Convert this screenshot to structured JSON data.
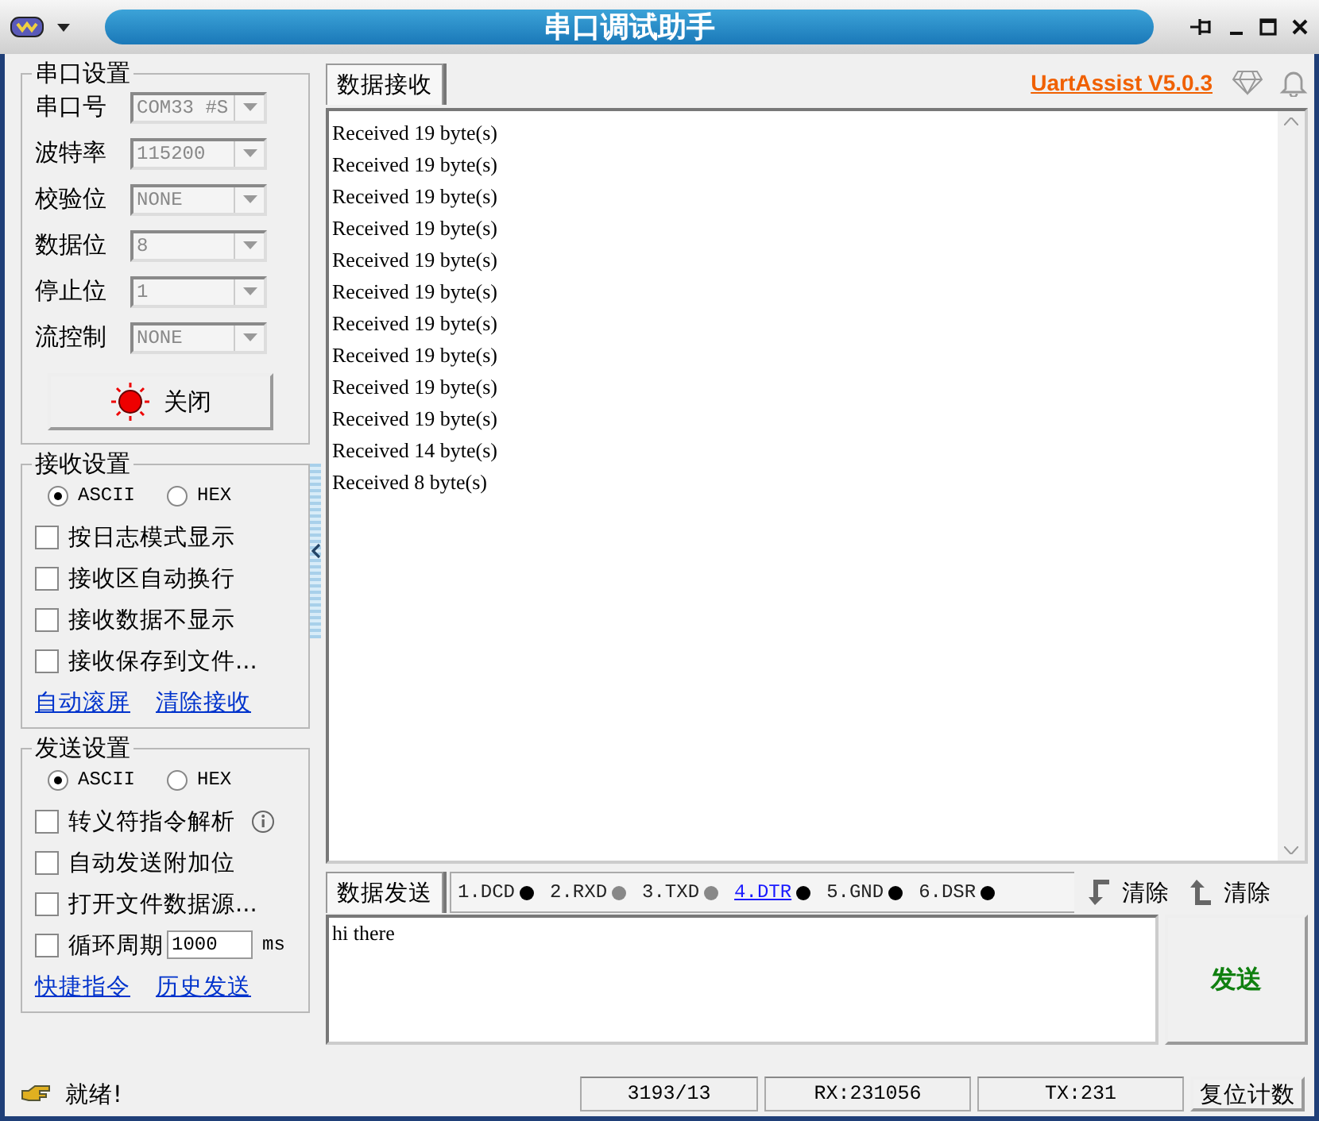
{
  "window": {
    "title": "串口调试助手"
  },
  "serial_settings": {
    "title": "串口设置",
    "fields": [
      {
        "label": "串口号",
        "value": "COM33 #S"
      },
      {
        "label": "波特率",
        "value": "115200"
      },
      {
        "label": "校验位",
        "value": "NONE"
      },
      {
        "label": "数据位",
        "value": "8"
      },
      {
        "label": "停止位",
        "value": "1"
      },
      {
        "label": "流控制",
        "value": "NONE"
      }
    ],
    "open_button": {
      "label": "关闭",
      "on": true
    }
  },
  "receive_settings": {
    "title": "接收设置",
    "modes": [
      {
        "label": "ASCII",
        "selected": true
      },
      {
        "label": "HEX",
        "selected": false
      }
    ],
    "options": [
      {
        "kind": "check",
        "label": "按日志模式显示",
        "checked": false
      },
      {
        "kind": "check",
        "label": "接收区自动换行",
        "checked": false
      },
      {
        "kind": "check",
        "label": "接收数据不显示",
        "checked": false
      },
      {
        "kind": "check",
        "label": "接收保存到文件...",
        "checked": false
      }
    ],
    "links": [
      "自动滚屏",
      "清除接收"
    ]
  },
  "send_settings": {
    "title": "发送设置",
    "modes": [
      {
        "label": "ASCII",
        "selected": true
      },
      {
        "label": "HEX",
        "selected": false
      }
    ],
    "options": [
      {
        "kind": "info",
        "label": "转义符指令解析",
        "checked": false
      },
      {
        "kind": "check",
        "label": "自动发送附加位",
        "checked": false
      },
      {
        "kind": "check",
        "label": "打开文件数据源...",
        "checked": false
      },
      {
        "kind": "period",
        "label": "循环周期",
        "checked": false,
        "value": "1000",
        "unit": "ms"
      }
    ],
    "links": [
      "快捷指令",
      "历史发送"
    ]
  },
  "receive": {
    "tab": "数据接收",
    "brand": "UartAssist V5.0.3",
    "lines": [
      "Received 19 byte(s)",
      "Received 19 byte(s)",
      "Received 19 byte(s)",
      "Received 19 byte(s)",
      "Received 19 byte(s)",
      "Received 19 byte(s)",
      "Received 19 byte(s)",
      "Received 19 byte(s)",
      "Received 19 byte(s)",
      "Received 19 byte(s)",
      "Received 14 byte(s)",
      "Received 8 byte(s)"
    ]
  },
  "send": {
    "tab": "数据发送",
    "signals": [
      {
        "label": "1.DCD",
        "on": true,
        "link": false
      },
      {
        "label": "2.RXD",
        "on": false,
        "link": false
      },
      {
        "label": "3.TXD",
        "on": false,
        "link": false
      },
      {
        "label": "4.DTR",
        "on": true,
        "link": true
      },
      {
        "label": "5.GND",
        "on": true,
        "link": false
      },
      {
        "label": "6.DSR",
        "on": true,
        "link": false
      }
    ],
    "clear_buttons": [
      {
        "kind": "down",
        "label": "清除"
      },
      {
        "kind": "up",
        "label": "清除"
      }
    ],
    "value": "hi there",
    "send_button": "发送"
  },
  "status_bar": {
    "message": "就绪!",
    "counts": [
      "3193/13",
      "RX:231056",
      "TX:231"
    ],
    "reset_button": "复位计数"
  }
}
